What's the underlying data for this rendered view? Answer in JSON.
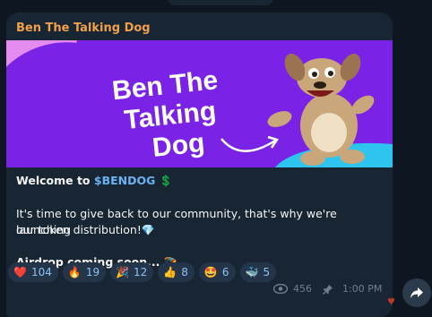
{
  "message": {
    "channel_name": "Ben The Talking Dog",
    "banner_title": [
      "Ben The",
      "Talking",
      "Dog"
    ],
    "welcome_prefix": "Welcome to ",
    "welcome_ticker": "$BENDOG",
    "welcome_emoji": "💲",
    "body_line1": "It's time to give back to our community, that's why we're launching",
    "body_line2": "our token distribution!",
    "body_emoji": "💎",
    "airdrop_text": "Airdrop coming soon...",
    "airdrop_emoji": "🪂"
  },
  "reactions": [
    {
      "emoji": "❤️",
      "count": "104"
    },
    {
      "emoji": "🔥",
      "count": "19"
    },
    {
      "emoji": "🎉",
      "count": "12"
    },
    {
      "emoji": "👍",
      "count": "8"
    },
    {
      "emoji": "🤩",
      "count": "6"
    },
    {
      "emoji": "🐳",
      "count": "5"
    }
  ],
  "meta": {
    "views": "456",
    "time": "1:00 PM"
  },
  "colors": {
    "channel_name": "#f0a04b",
    "ticker": "#6ab3f3",
    "banner_bg": "#7a22e6"
  }
}
